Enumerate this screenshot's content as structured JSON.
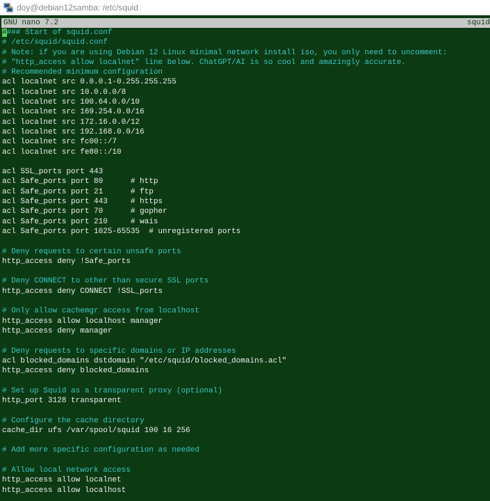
{
  "window": {
    "title": "doy@debian12samba: /etc/squid"
  },
  "nano": {
    "version_label": "GNU nano 7.2",
    "filename": "squid"
  },
  "editor": {
    "cursor_char": "#",
    "first_line_rest": "### Start of squid.conf",
    "lines": [
      {
        "text": "# /etc/squid/squid.conf",
        "type": "comment"
      },
      {
        "text": "# Note: if you are using Debian 12 Linux minimal network install iso, you only need to uncomment:",
        "type": "comment"
      },
      {
        "text": "# \"http_access allow localnet\" line below. ChatGPT/AI is so cool and amazingly accurate.",
        "type": "comment"
      },
      {
        "text": "# Recommended minimum configuration",
        "type": "comment"
      },
      {
        "text": "acl localnet src 0.0.0.1-0.255.255.255",
        "type": "code"
      },
      {
        "text": "acl localnet src 10.0.0.0/8",
        "type": "code"
      },
      {
        "text": "acl localnet src 100.64.0.0/10",
        "type": "code"
      },
      {
        "text": "acl localnet src 169.254.0.0/16",
        "type": "code"
      },
      {
        "text": "acl localnet src 172.16.0.0/12",
        "type": "code"
      },
      {
        "text": "acl localnet src 192.168.0.0/16",
        "type": "code"
      },
      {
        "text": "acl localnet src fc00::/7",
        "type": "code"
      },
      {
        "text": "acl localnet src fe80::/10",
        "type": "code"
      },
      {
        "text": "",
        "type": "code"
      },
      {
        "text": "acl SSL_ports port 443",
        "type": "code"
      },
      {
        "text": "acl Safe_ports port 80      # http",
        "type": "code"
      },
      {
        "text": "acl Safe_ports port 21      # ftp",
        "type": "code"
      },
      {
        "text": "acl Safe_ports port 443     # https",
        "type": "code"
      },
      {
        "text": "acl Safe_ports port 70      # gopher",
        "type": "code"
      },
      {
        "text": "acl Safe_ports port 210     # wais",
        "type": "code"
      },
      {
        "text": "acl Safe_ports port 1025-65535  # unregistered ports",
        "type": "code"
      },
      {
        "text": "",
        "type": "code"
      },
      {
        "text": "# Deny requests to certain unsafe ports",
        "type": "comment"
      },
      {
        "text": "http_access deny !Safe_ports",
        "type": "code"
      },
      {
        "text": "",
        "type": "code"
      },
      {
        "text": "# Deny CONNECT to other than secure SSL ports",
        "type": "comment"
      },
      {
        "text": "http_access deny CONNECT !SSL_ports",
        "type": "code"
      },
      {
        "text": "",
        "type": "code"
      },
      {
        "text": "# Only allow cachemgr access from localhost",
        "type": "comment"
      },
      {
        "text": "http_access allow localhost manager",
        "type": "code"
      },
      {
        "text": "http_access deny manager",
        "type": "code"
      },
      {
        "text": "",
        "type": "code"
      },
      {
        "text": "# Deny requests to specific domains or IP addresses",
        "type": "comment"
      },
      {
        "text": "acl blocked_domains dstdomain \"/etc/squid/blocked_domains.acl\"",
        "type": "code"
      },
      {
        "text": "http_access deny blocked_domains",
        "type": "code"
      },
      {
        "text": "",
        "type": "code"
      },
      {
        "text": "# Set up Squid as a transparent proxy (optional)",
        "type": "comment"
      },
      {
        "text": "http_port 3128 transparent",
        "type": "code"
      },
      {
        "text": "",
        "type": "code"
      },
      {
        "text": "# Configure the cache directory",
        "type": "comment"
      },
      {
        "text": "cache_dir ufs /var/spool/squid 100 16 256",
        "type": "code"
      },
      {
        "text": "",
        "type": "code"
      },
      {
        "text": "# Add more specific configuration as needed",
        "type": "comment"
      },
      {
        "text": "",
        "type": "code"
      },
      {
        "text": "# Allow local network access",
        "type": "comment"
      },
      {
        "text": "http_access allow localnet",
        "type": "code"
      },
      {
        "text": "http_access allow localhost",
        "type": "code"
      }
    ]
  },
  "colors": {
    "terminal_bg": "#0c3a12",
    "comment": "#3fc6c6",
    "code": "#f0f0f0",
    "header_bg": "#c8c8c8",
    "cursor": "#5fd35f"
  },
  "icons": {
    "app": "putty-terminal-icon"
  }
}
